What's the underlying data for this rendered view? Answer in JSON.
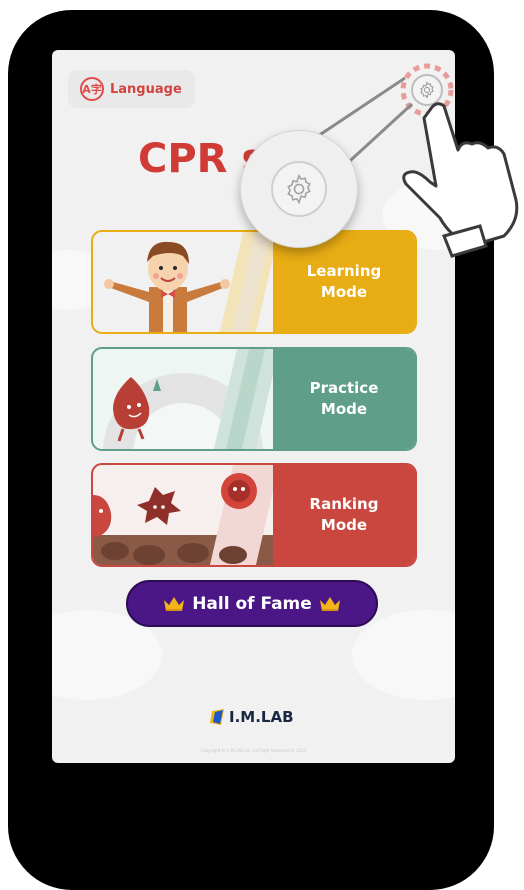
{
  "header": {
    "language_label": "Language",
    "language_icon": "language-icon",
    "settings_icon": "gear-icon"
  },
  "app": {
    "title": "CPR s"
  },
  "modes": [
    {
      "label": "Learning\nMode",
      "color": "#e8ac14"
    },
    {
      "label": "Practice\nMode",
      "color": "#5f9e88"
    },
    {
      "label": "Ranking\nMode",
      "color": "#c9473e"
    }
  ],
  "hall_of_fame": {
    "label": "Hall of Fame",
    "icon": "crown-icon",
    "color": "#4b1686"
  },
  "footer": {
    "logo_text": "I.M.LAB",
    "copyright": "Copyright (c) I.M.LAB Inc. All Right Reserved © 2023"
  },
  "callout": {
    "icon": "gear-icon",
    "pointer": "hand-pointer-icon"
  }
}
